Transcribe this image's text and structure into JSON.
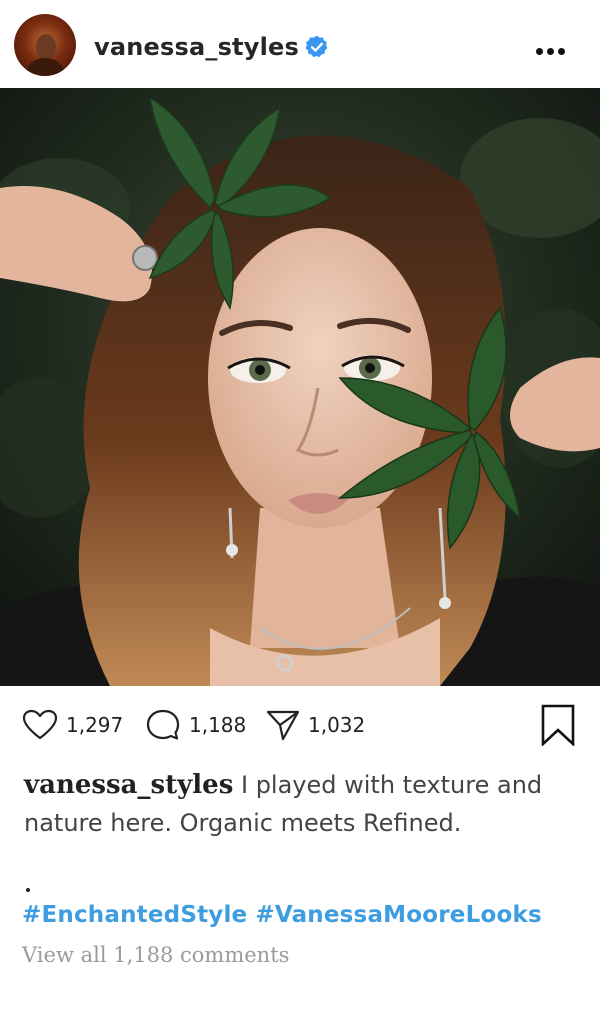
{
  "header": {
    "username": "vanessa_styles",
    "verified": true,
    "avatar": "profile-avatar",
    "more_icon": "more-horizontal-icon"
  },
  "photo": {
    "subject": "woman with green leaves",
    "description_icon": "post-photo"
  },
  "actions": {
    "likes": "1,297",
    "comments": "1,188",
    "shares": "1,032",
    "like_icon": "heart-icon",
    "comment_icon": "comment-icon",
    "share_icon": "send-icon",
    "save_icon": "bookmark-icon"
  },
  "caption": {
    "username": "vanessa_styles",
    "text": "I played with texture and nature here. Organic meets Refined."
  },
  "hashtags": [
    "#EnchantedStyle",
    "#VanessaMooreLooks"
  ],
  "view_all_comments": "View all 1,188 comments",
  "colors": {
    "hashtag": "#3d9de0",
    "verified": "#3897f0",
    "muted": "#9a9a9a",
    "text": "#222222"
  }
}
